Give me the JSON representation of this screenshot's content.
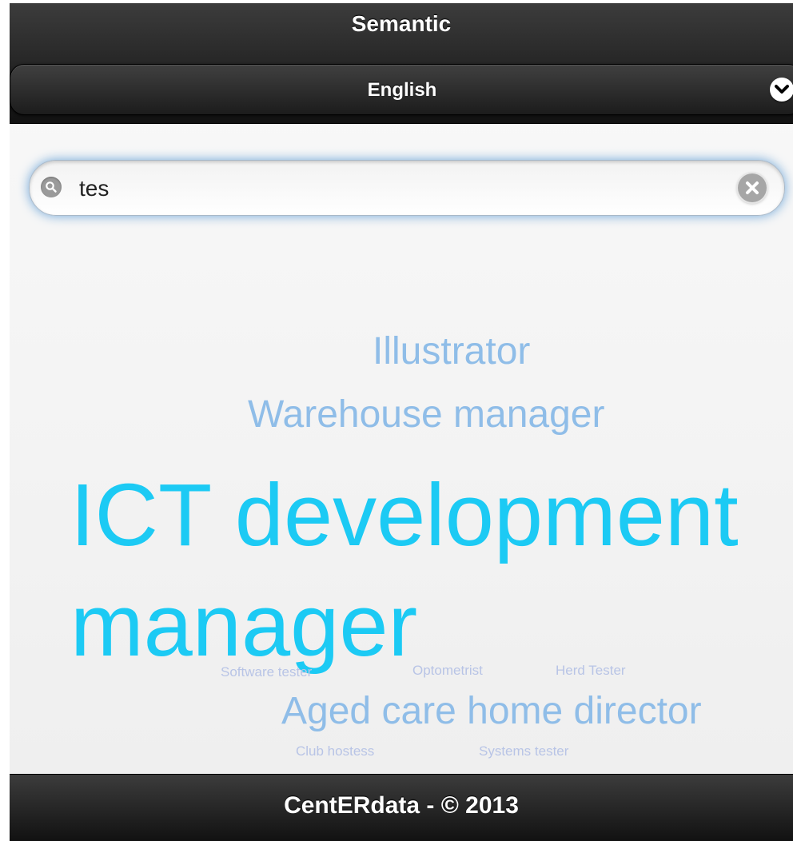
{
  "header": {
    "title": "Semantic"
  },
  "language_select": {
    "selected": "English",
    "icon": "chevron-down-icon"
  },
  "search": {
    "value": "tes",
    "search_icon": "search-icon",
    "clear_icon": "clear-icon"
  },
  "tag_cloud": {
    "tags": [
      {
        "label": "Illustrator",
        "color": "#8fbde8"
      },
      {
        "label": "Warehouse manager",
        "color": "#8fbde8"
      },
      {
        "label": "ICT development manager",
        "color": "#1ccaf4"
      },
      {
        "label": "Software tester",
        "color": "#b8c4e6"
      },
      {
        "label": "Optometrist",
        "color": "#b8c4e6"
      },
      {
        "label": "Herd Tester",
        "color": "#b8c4e6"
      },
      {
        "label": "Aged care home director",
        "color": "#8fbde8"
      },
      {
        "label": "Club hostess",
        "color": "#b8c4e6"
      },
      {
        "label": "Systems tester",
        "color": "#b8c4e6"
      }
    ]
  },
  "footer": {
    "text": "CentERdata - © 2013"
  },
  "colors": {
    "bar": "#1f1f1f",
    "focus_glow": "#6fa6d8",
    "page_bg": "#f4f4f4"
  }
}
